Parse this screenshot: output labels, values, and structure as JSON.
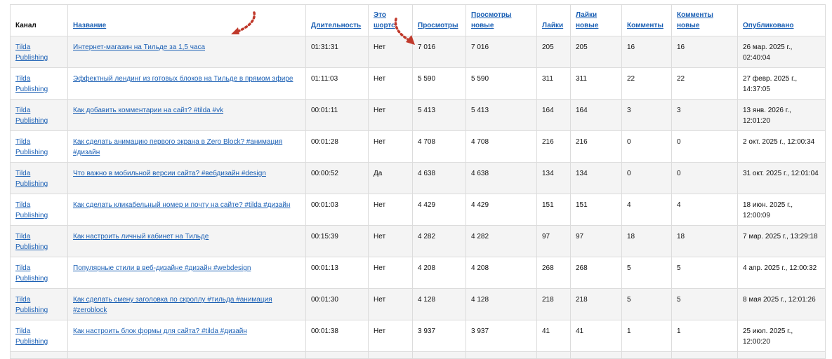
{
  "columns": [
    {
      "key": "channel",
      "label": "Канал",
      "sortable": false
    },
    {
      "key": "title",
      "label": "Название",
      "sortable": true
    },
    {
      "key": "duration",
      "label": "Длительность",
      "sortable": true
    },
    {
      "key": "is_short",
      "label": "Это шортс",
      "sortable": true
    },
    {
      "key": "views",
      "label": "Просмотры",
      "sortable": true
    },
    {
      "key": "views_new",
      "label": "Просмотры новые",
      "sortable": true
    },
    {
      "key": "likes",
      "label": "Лайки",
      "sortable": true
    },
    {
      "key": "likes_new",
      "label": "Лайки новые",
      "sortable": true
    },
    {
      "key": "comments",
      "label": "Комменты",
      "sortable": true
    },
    {
      "key": "comments_new",
      "label": "Комменты новые",
      "sortable": true
    },
    {
      "key": "published",
      "label": "Опубликовано",
      "sortable": true
    }
  ],
  "rows": [
    {
      "channel": "Tilda Publishing",
      "title": "Интернет-магазин на Тильде за 1,5 часа",
      "duration": "01:31:31",
      "is_short": "Нет",
      "views": "7 016",
      "views_new": "7 016",
      "likes": "205",
      "likes_new": "205",
      "comments": "16",
      "comments_new": "16",
      "published": "26 мар. 2025 г., 02:40:04"
    },
    {
      "channel": "Tilda Publishing",
      "title": "Эффектный лендинг из готовых блоков на Тильде в прямом эфире",
      "duration": "01:11:03",
      "is_short": "Нет",
      "views": "5 590",
      "views_new": "5 590",
      "likes": "311",
      "likes_new": "311",
      "comments": "22",
      "comments_new": "22",
      "published": "27 февр. 2025 г., 14:37:05"
    },
    {
      "channel": "Tilda Publishing",
      "title": "Как добавить комментарии на сайт? #tilda #vk",
      "duration": "00:01:11",
      "is_short": "Нет",
      "views": "5 413",
      "views_new": "5 413",
      "likes": "164",
      "likes_new": "164",
      "comments": "3",
      "comments_new": "3",
      "published": "13 янв. 2026 г., 12:01:20"
    },
    {
      "channel": "Tilda Publishing",
      "title": "Как сделать анимацию первого экрана в Zero Block? #анимация #дизайн",
      "duration": "00:01:28",
      "is_short": "Нет",
      "views": "4 708",
      "views_new": "4 708",
      "likes": "216",
      "likes_new": "216",
      "comments": "0",
      "comments_new": "0",
      "published": "2 окт. 2025 г., 12:00:34"
    },
    {
      "channel": "Tilda Publishing",
      "title": "Что важно в мобильной версии сайта? #вебдизайн #design",
      "duration": "00:00:52",
      "is_short": "Да",
      "views": "4 638",
      "views_new": "4 638",
      "likes": "134",
      "likes_new": "134",
      "comments": "0",
      "comments_new": "0",
      "published": "31 окт. 2025 г., 12:01:04"
    },
    {
      "channel": "Tilda Publishing",
      "title": "Как сделать кликабельный номер и почту на сайте? #tilda #дизайн",
      "duration": "00:01:03",
      "is_short": "Нет",
      "views": "4 429",
      "views_new": "4 429",
      "likes": "151",
      "likes_new": "151",
      "comments": "4",
      "comments_new": "4",
      "published": "18 июн. 2025 г., 12:00:09"
    },
    {
      "channel": "Tilda Publishing",
      "title": "Как настроить личный кабинет на Тильде",
      "duration": "00:15:39",
      "is_short": "Нет",
      "views": "4 282",
      "views_new": "4 282",
      "likes": "97",
      "likes_new": "97",
      "comments": "18",
      "comments_new": "18",
      "published": "7 мар. 2025 г., 13:29:18"
    },
    {
      "channel": "Tilda Publishing",
      "title": "Популярные стили в веб-дизайне #дизайн #webdesign",
      "duration": "00:01:13",
      "is_short": "Нет",
      "views": "4 208",
      "views_new": "4 208",
      "likes": "268",
      "likes_new": "268",
      "comments": "5",
      "comments_new": "5",
      "published": "4 апр. 2025 г., 12:00:32"
    },
    {
      "channel": "Tilda Publishing",
      "title": "Как сделать смену заголовка по скроллу #тильда #анимация #zeroblock",
      "duration": "00:01:30",
      "is_short": "Нет",
      "views": "4 128",
      "views_new": "4 128",
      "likes": "218",
      "likes_new": "218",
      "comments": "5",
      "comments_new": "5",
      "published": "8 мая 2025 г., 12:01:26"
    },
    {
      "channel": "Tilda Publishing",
      "title": "Как настроить блок формы для сайта? #tilda #дизайн",
      "duration": "00:01:38",
      "is_short": "Нет",
      "views": "3 937",
      "views_new": "3 937",
      "likes": "41",
      "likes_new": "41",
      "comments": "1",
      "comments_new": "1",
      "published": "25 июл. 2025 г., 12:00:20"
    }
  ],
  "colors": {
    "link": "#1a5fb4",
    "arrow": "#c0392b",
    "row_alt": "#f4f4f4",
    "border": "#dcdcdc"
  },
  "icons": [
    "arrow-annotation-icon"
  ]
}
